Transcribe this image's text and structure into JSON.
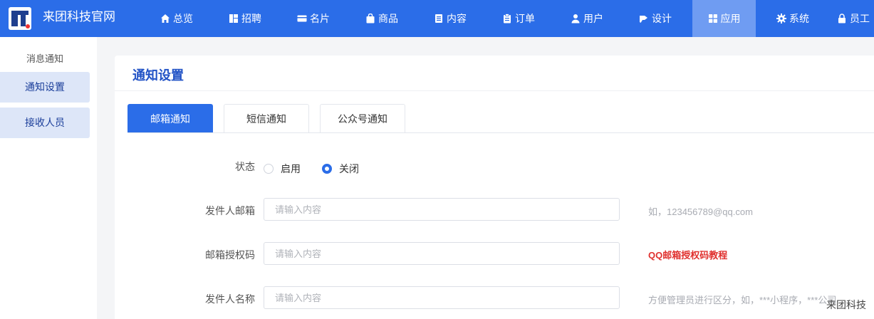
{
  "brand": {
    "name": "来团科技官网"
  },
  "nav": {
    "items": [
      {
        "label": "总览",
        "icon": "home-icon"
      },
      {
        "label": "招聘",
        "icon": "recruit-icon"
      },
      {
        "label": "名片",
        "icon": "card-icon"
      },
      {
        "label": "商品",
        "icon": "bag-icon"
      },
      {
        "label": "内容",
        "icon": "document-icon"
      },
      {
        "label": "订单",
        "icon": "clipboard-icon"
      },
      {
        "label": "用户",
        "icon": "user-icon"
      },
      {
        "label": "设计",
        "icon": "design-icon"
      },
      {
        "label": "应用",
        "icon": "apps-icon"
      },
      {
        "label": "系统",
        "icon": "gear-icon"
      },
      {
        "label": "员工",
        "icon": "lock-icon"
      }
    ],
    "active_index": 8
  },
  "sidebar": {
    "title": "消息通知",
    "items": [
      {
        "label": "通知设置"
      },
      {
        "label": "接收人员"
      }
    ]
  },
  "panel": {
    "title": "通知设置",
    "tabs": [
      {
        "label": "邮箱通知"
      },
      {
        "label": "短信通知"
      },
      {
        "label": "公众号通知"
      }
    ],
    "active_tab": 0
  },
  "form": {
    "status": {
      "label": "状态",
      "options": [
        "启用",
        "关闭"
      ],
      "selected": "关闭"
    },
    "sender_email": {
      "label": "发件人邮箱",
      "placeholder": "请输入内容",
      "value": "",
      "hint": "如，123456789@qq.com"
    },
    "auth_code": {
      "label": "邮箱授权码",
      "placeholder": "请输入内容",
      "value": "",
      "link": "QQ邮箱授权码教程"
    },
    "sender_name": {
      "label": "发件人名称",
      "placeholder": "请输入内容",
      "value": "",
      "hint": "方便管理员进行区分，如，***小程序，***公司"
    }
  },
  "watermark": "来团科技",
  "colors": {
    "primary": "#2b6de8",
    "nav_active": "#6f9cf2",
    "sidebar_active": "#dde6f8",
    "link_red": "#e0312f"
  }
}
